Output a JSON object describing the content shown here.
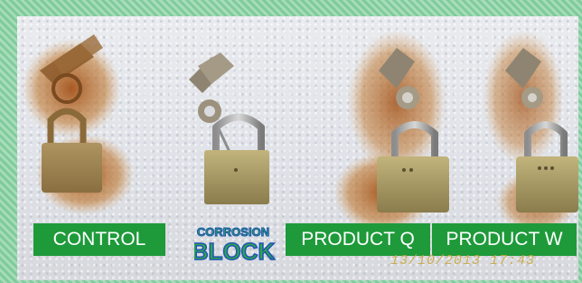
{
  "labels": {
    "control": "CONTROL",
    "product_q": "PRODUCT Q",
    "product_w": "PRODUCT W"
  },
  "logo": {
    "line1": "CORROSION",
    "line2": "BLOCK",
    "registered": "®"
  },
  "timestamp": "13/10/2013 17:43",
  "colors": {
    "label_green": "#1e9a3a",
    "logo_blue": "#1f55b5",
    "logo_green": "#2ea64a",
    "rust": "#b5651d",
    "brass": "#a99a64",
    "border_green": "#8fd1a8"
  }
}
